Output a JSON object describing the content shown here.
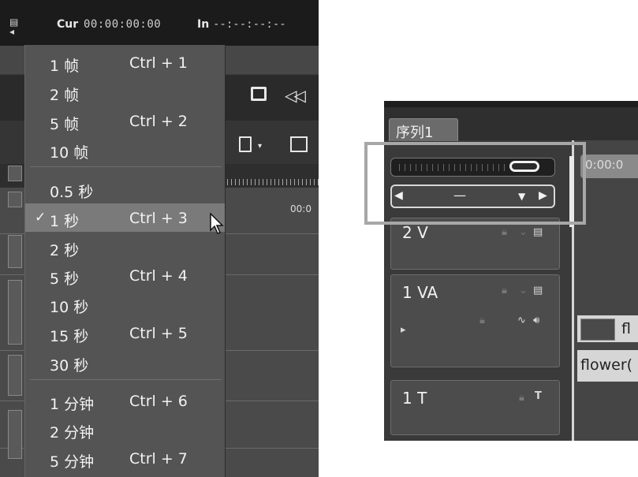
{
  "top_bar": {
    "cur_label": "Cur",
    "cur_value": "00:00:00:00",
    "in_label": "In",
    "in_value": "--:--:--:--"
  },
  "ruler_text": "00:0",
  "zoom_menu": {
    "items": [
      {
        "label": "1 帧",
        "shortcut": "Ctrl + 1",
        "checked": false
      },
      {
        "label": "2 帧",
        "shortcut": "",
        "checked": false
      },
      {
        "label": "5 帧",
        "shortcut": "Ctrl + 2",
        "checked": false
      },
      {
        "label": "10 帧",
        "shortcut": "",
        "checked": false
      },
      {
        "label": "0.5 秒",
        "shortcut": "",
        "checked": false
      },
      {
        "label": "1 秒",
        "shortcut": "Ctrl + 3",
        "checked": true
      },
      {
        "label": "2 秒",
        "shortcut": "",
        "checked": false
      },
      {
        "label": "5 秒",
        "shortcut": "Ctrl + 4",
        "checked": false
      },
      {
        "label": "10 秒",
        "shortcut": "",
        "checked": false
      },
      {
        "label": "15 秒",
        "shortcut": "Ctrl + 5",
        "checked": false
      },
      {
        "label": "30 秒",
        "shortcut": "",
        "checked": false
      },
      {
        "label": "1 分钟",
        "shortcut": "Ctrl + 6",
        "checked": false
      },
      {
        "label": "2 分钟",
        "shortcut": "",
        "checked": false
      },
      {
        "label": "5 分钟",
        "shortcut": "Ctrl + 7",
        "checked": false
      }
    ],
    "check_mark": "✓"
  },
  "sequence_panel": {
    "tab_label": "序列1",
    "zoom_select_value": "—",
    "timecode": "0:00:0",
    "tracks": [
      {
        "name": "2 V"
      },
      {
        "name": "1 VA"
      },
      {
        "name": "1 T"
      }
    ],
    "clip_a_text": "fl",
    "clip_b_text": "flower("
  },
  "colors": {
    "menu_bg": "#545454",
    "menu_active": "#7a7a7a",
    "highlight_frame": "#a7a7a7"
  }
}
